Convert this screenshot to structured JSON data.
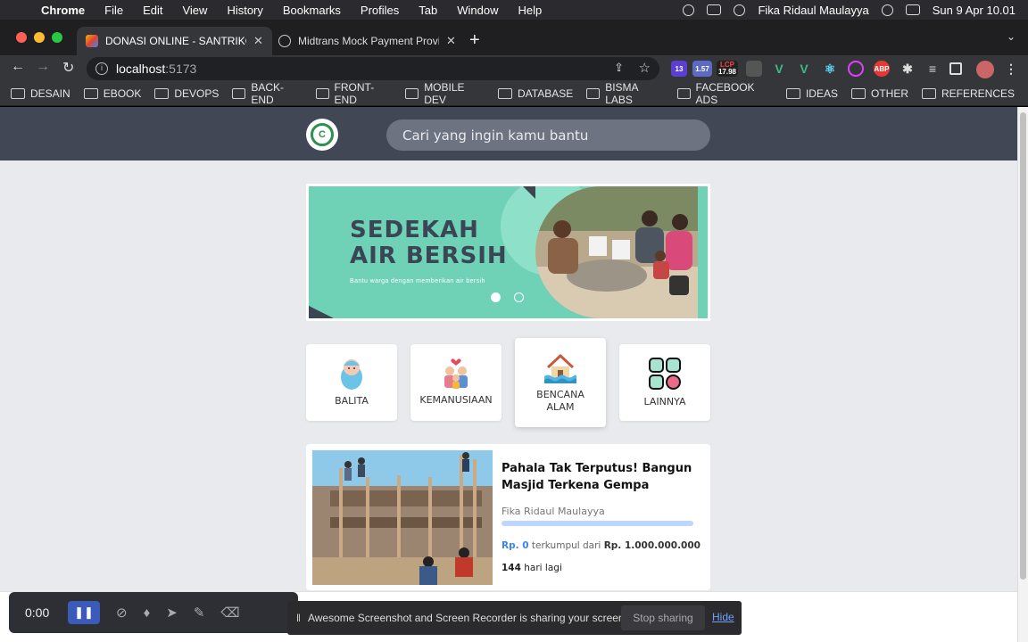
{
  "os_menubar": {
    "app": "Chrome",
    "items": [
      "File",
      "Edit",
      "View",
      "History",
      "Bookmarks",
      "Profiles",
      "Tab",
      "Window",
      "Help"
    ],
    "user": "Fika Ridaul Maulayya",
    "datetime": "Sun 9 Apr  10.01"
  },
  "tabs": [
    {
      "title": "DONASI ONLINE - SANTRIKODI",
      "active": true
    },
    {
      "title": "Midtrans Mock Payment Provid",
      "active": false
    }
  ],
  "address_bar": {
    "host": "localhost",
    "port": ":5173"
  },
  "extensions": {
    "badge_13": "13",
    "badge_157": "1.57",
    "lcp_label": "LCP",
    "lcp_value": "17.98",
    "abp": "ABP"
  },
  "bookmarks": [
    "DESAIN",
    "EBOOK",
    "DEVOPS",
    "BACK-END",
    "FRONT-END",
    "MOBILE DEV",
    "DATABASE",
    "BISMA LABS",
    "FACEBOOK ADS",
    "IDEAS",
    "OTHER",
    "REFERENCES"
  ],
  "site": {
    "logo_text": "C",
    "search_placeholder": "Cari yang ingin kamu bantu"
  },
  "banner": {
    "title_line1": "SEDEKAH",
    "title_line2": "AIR BERSIH",
    "subtitle": "Bantu warga dengan memberikan air bersih",
    "slides": 2,
    "active_slide": 1
  },
  "categories": [
    {
      "label": "BALITA",
      "icon": "baby-icon"
    },
    {
      "label": "KEMANUSIAAN",
      "icon": "family-icon"
    },
    {
      "label": "BENCANA ALAM",
      "icon": "flood-house-icon"
    },
    {
      "label": "LAINNYA",
      "icon": "grid-icon"
    }
  ],
  "campaign": {
    "title": "Pahala Tak Terputus! Bangun Masjid Terkena Gempa",
    "author": "Fika Ridaul Maulayya",
    "progress_percent": 0,
    "raised": "Rp. 0",
    "raised_word": "terkumpul dari",
    "target": "Rp. 1.000.000.000",
    "days_count": "144",
    "days_label": "hari lagi"
  },
  "recorder": {
    "time": "0:00",
    "share_message": "Awesome Screenshot and Screen Recorder is sharing your screen.",
    "stop_label": "Stop sharing",
    "hide_label": "Hide"
  },
  "colors": {
    "header_bg": "#414754",
    "banner_bg": "#6fd1b6",
    "accent_blue": "#3b82f6"
  }
}
